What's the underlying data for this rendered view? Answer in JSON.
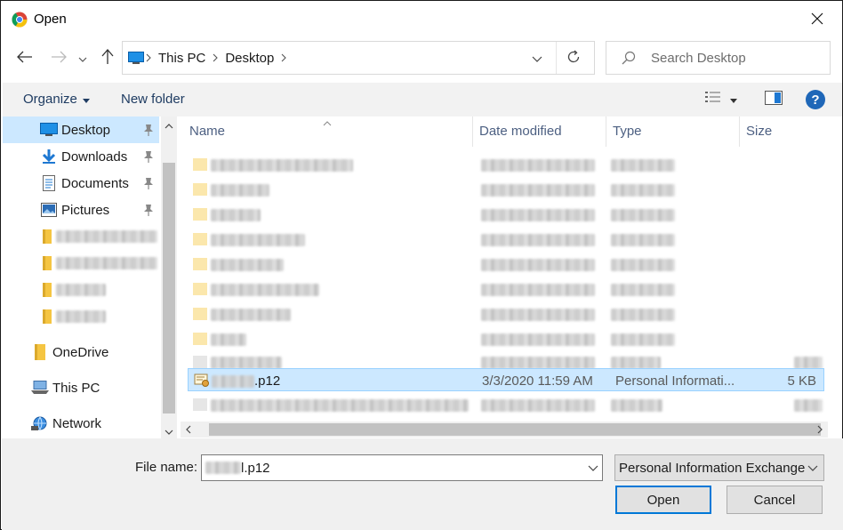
{
  "window": {
    "title": "Open",
    "app_icon": "chrome-icon",
    "close_icon": "close-icon"
  },
  "navigation": {
    "back_icon": "back-arrow-icon",
    "forward_icon": "forward-arrow-icon",
    "recent_icon": "chevron-down-icon",
    "up_icon": "up-arrow-icon"
  },
  "address": {
    "crumbs": [
      "This PC",
      "Desktop"
    ],
    "refresh_icon": "refresh-icon"
  },
  "search": {
    "placeholder": "Search Desktop"
  },
  "toolbar": {
    "organize_label": "Organize",
    "new_folder_label": "New folder",
    "help_label": "?"
  },
  "sidebar": {
    "items": [
      {
        "label": "Desktop",
        "icon": "desktop-icon",
        "pinned": true,
        "selected": true
      },
      {
        "label": "Downloads",
        "icon": "downloads-icon",
        "pinned": true
      },
      {
        "label": "Documents",
        "icon": "documents-icon",
        "pinned": true
      },
      {
        "label": "Pictures",
        "icon": "pictures-icon",
        "pinned": true
      },
      {
        "label": "",
        "icon": "folder-icon",
        "blurred": true
      },
      {
        "label": "",
        "icon": "folder-icon",
        "blurred": true
      },
      {
        "label": "",
        "icon": "folder-icon",
        "blurred": true
      },
      {
        "label": "",
        "icon": "folder-icon",
        "blurred": true
      },
      {
        "label": "OneDrive",
        "icon": "onedrive-icon"
      },
      {
        "label": "This PC",
        "icon": "this-pc-icon"
      },
      {
        "label": "Network",
        "icon": "network-icon"
      }
    ]
  },
  "file_list": {
    "columns": [
      "Name",
      "Date modified",
      "Type",
      "Size"
    ],
    "selected_file": {
      "name_suffix": ".p12",
      "date": "3/3/2020 11:59 AM",
      "type": "Personal Informati...",
      "size": "5 KB"
    }
  },
  "bottom": {
    "file_name_label": "File name:",
    "file_name_suffix": "l.p12",
    "file_type": "Personal Information Exchange",
    "open_label": "Open",
    "cancel_label": "Cancel"
  },
  "colors": {
    "selection": "#cce8ff",
    "selection_border": "#99d1ff",
    "link_text": "#1f3c62",
    "primary_border": "#0078d7"
  }
}
